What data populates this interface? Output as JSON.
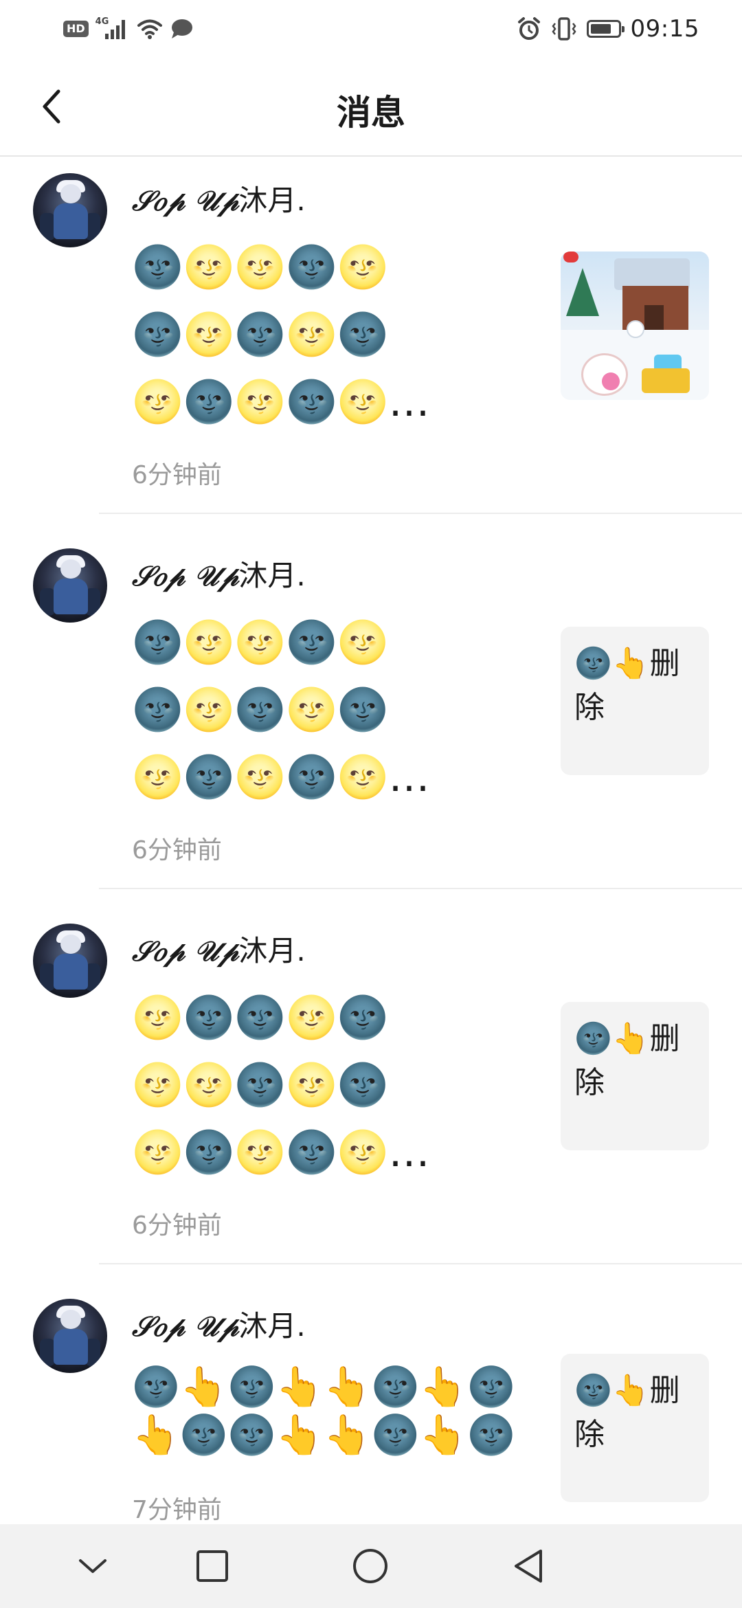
{
  "status_bar": {
    "left_icons": [
      "hd-icon",
      "signal-4g-icon",
      "wifi-icon",
      "message-icon"
    ],
    "hd_label": "HD",
    "network_label": "4G",
    "right_icons": [
      "alarm-icon",
      "vibrate-icon",
      "battery-icon"
    ],
    "battery_level": 0.75,
    "time": "09:15"
  },
  "header": {
    "title": "消息",
    "back_icon": "chevron-left-icon"
  },
  "messages": [
    {
      "name_script": "𝒮𝑜𝓅 𝒰𝓅",
      "name_tail": "沐月.",
      "lines": [
        "🌚🌝🌝🌚🌝",
        "🌚🌝🌚🌝🌚",
        "🌝🌚🌝🌚🌝…"
      ],
      "time": "6分钟前",
      "thumbnail": {
        "type": "image",
        "icon": "game-screenshot-image"
      }
    },
    {
      "name_script": "𝒮𝑜𝓅 𝒰𝓅",
      "name_tail": "沐月.",
      "lines": [
        "🌚🌝🌝🌚🌝",
        "🌚🌝🌚🌝🌚",
        "🌝🌚🌝🌚🌝…"
      ],
      "time": "6分钟前",
      "thumbnail": {
        "type": "text",
        "text": "🌚👆删除"
      }
    },
    {
      "name_script": "𝒮𝑜𝓅 𝒰𝓅",
      "name_tail": "沐月.",
      "lines": [
        "🌝🌚🌚🌝🌚",
        "🌝🌝🌚🌝🌚",
        "🌝🌚🌝🌚🌝…"
      ],
      "time": "6分钟前",
      "thumbnail": {
        "type": "text",
        "text": "🌚👆删除"
      }
    },
    {
      "name_script": "𝒮𝑜𝓅 𝒰𝓅",
      "name_tail": "沐月.",
      "lines": [
        "🌚👆🌚👆👆🌚👆🌚",
        "👆🌚🌚👆👆🌚👆🌚"
      ],
      "time": "7分钟前",
      "thumbnail": {
        "type": "text",
        "text": "🌚👆删除"
      }
    }
  ],
  "nav_bar": {
    "buttons": [
      "collapse-down-icon",
      "recents-square-icon",
      "home-circle-icon",
      "back-triangle-icon"
    ]
  }
}
